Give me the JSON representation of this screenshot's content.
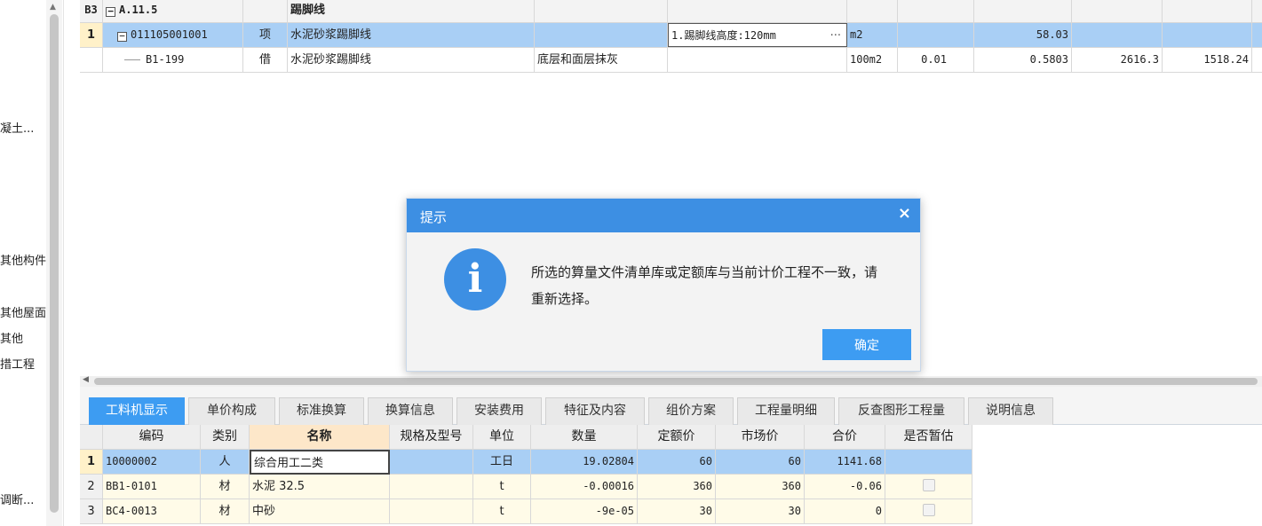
{
  "sidebar": {
    "items": [
      "凝土...",
      "其他构件",
      "其他屋面",
      "其他",
      "措工程",
      "调断..."
    ],
    "scroll_up": "▲"
  },
  "top_grid": {
    "section_row": {
      "num": "B3",
      "code": "A.11.5",
      "name": "踢脚线"
    },
    "rows": [
      {
        "num": "1",
        "code": "011105001001",
        "type": "项",
        "name": "水泥砂浆踢脚线",
        "desc": "",
        "features": "1.踢脚线高度:120mm",
        "features_more": "···",
        "unit": "m2",
        "qty_content": "",
        "qty": "58.03",
        "unit_price": "",
        "total": ""
      },
      {
        "num": "",
        "code": "B1-199",
        "type": "借",
        "name": "水泥砂浆踢脚线",
        "desc": "底层和面层抹灰",
        "features": "",
        "unit": "100m2",
        "qty_content": "0.01",
        "qty": "0.5803",
        "unit_price": "2616.3",
        "total": "1518.24"
      }
    ]
  },
  "hscroll": {
    "left_arrow": "◀"
  },
  "tabs": [
    {
      "label": "工料机显示",
      "active": true
    },
    {
      "label": "单价构成"
    },
    {
      "label": "标准换算"
    },
    {
      "label": "换算信息"
    },
    {
      "label": "安装费用"
    },
    {
      "label": "特征及内容"
    },
    {
      "label": "组价方案"
    },
    {
      "label": "工程量明细"
    },
    {
      "label": "反查图形工程量"
    },
    {
      "label": "说明信息"
    }
  ],
  "bottom_grid": {
    "headers": [
      "编码",
      "类别",
      "名称",
      "规格及型号",
      "单位",
      "数量",
      "定额价",
      "市场价",
      "合价",
      "是否暂估"
    ],
    "rows": [
      {
        "num": "1",
        "code": "10000002",
        "category": "人",
        "name": "综合用工二类",
        "spec": "",
        "unit": "工日",
        "qty": "19.02804",
        "quota_price": "60",
        "market_price": "60",
        "total": "1141.68",
        "estimated": false
      },
      {
        "num": "2",
        "code": "BB1-0101",
        "category": "材",
        "name": "水泥 32.5",
        "spec": "",
        "unit": "t",
        "qty": "-0.00016",
        "quota_price": "360",
        "market_price": "360",
        "total": "-0.06",
        "estimated": false
      },
      {
        "num": "3",
        "code": "BC4-0013",
        "category": "材",
        "name": "中砂",
        "spec": "",
        "unit": "t",
        "qty": "-9e-05",
        "quota_price": "30",
        "market_price": "30",
        "total": "0",
        "estimated": false
      }
    ]
  },
  "dialog": {
    "title": "提示",
    "close": "×",
    "icon": "info-icon",
    "icon_glyph": "i",
    "message": "所选的算量文件清单库或定额库与当前计价工程不一致，请重新选择。",
    "ok_label": "确定"
  },
  "colors": {
    "accent": "#3d8fe3",
    "selected_row": "#a9cff5",
    "button": "#3d9cf2"
  }
}
